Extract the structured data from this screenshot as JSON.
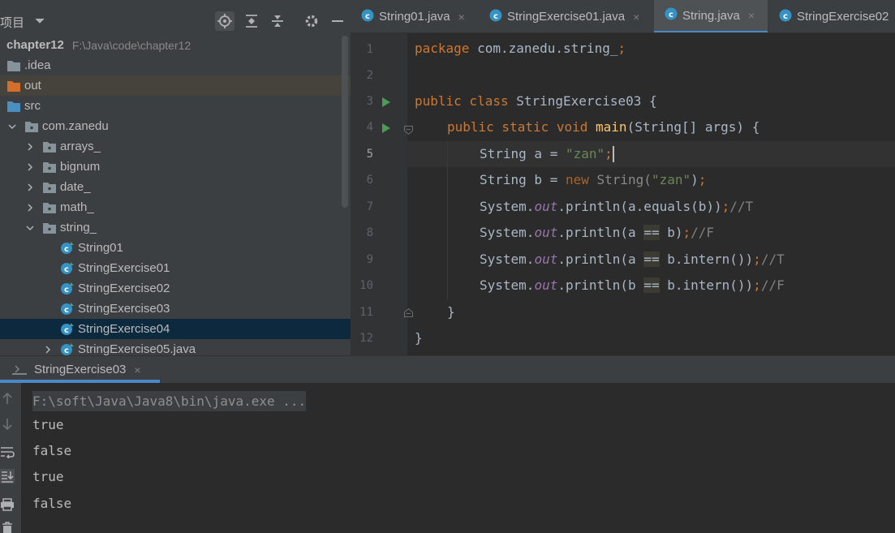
{
  "project_panel": {
    "title": "项目",
    "root_name": "chapter12",
    "root_path": "F:\\Java\\code\\chapter12",
    "items": [
      {
        "label": "chapter12",
        "kind": "module"
      },
      {
        "label": ".idea",
        "kind": "folder"
      },
      {
        "label": "out",
        "kind": "folder-excluded"
      },
      {
        "label": "src",
        "kind": "folder-source"
      },
      {
        "label": "com.zanedu",
        "kind": "package"
      },
      {
        "label": "arrays_",
        "kind": "package"
      },
      {
        "label": "bignum",
        "kind": "package"
      },
      {
        "label": "date_",
        "kind": "package"
      },
      {
        "label": "math_",
        "kind": "package"
      },
      {
        "label": "string_",
        "kind": "package"
      },
      {
        "label": "String01",
        "kind": "class"
      },
      {
        "label": "StringExercise01",
        "kind": "class"
      },
      {
        "label": "StringExercise02",
        "kind": "class"
      },
      {
        "label": "StringExercise03",
        "kind": "class"
      },
      {
        "label": "StringExercise04",
        "kind": "class"
      },
      {
        "label": "StringExercise05.java",
        "kind": "class"
      }
    ]
  },
  "editor_tabs": [
    {
      "label": "String01.java",
      "close": "×"
    },
    {
      "label": "StringExercise01.java",
      "close": "×"
    },
    {
      "label": "String.java",
      "close": "×"
    },
    {
      "label": "StringExercise02",
      "close": ""
    }
  ],
  "editor": {
    "line_numbers": [
      "1",
      "2",
      "3",
      "4",
      "5",
      "6",
      "7",
      "8",
      "9",
      "10",
      "11",
      "12"
    ],
    "code": {
      "l1_kw": "package",
      "l1_rest": " com.zanedu.string_",
      "l1_semi": ";",
      "l3_kw": "public class",
      "l3_rest": " StringExercise03 {",
      "l4_kw": "public static void",
      "l4_fn": "main",
      "l4_rest": "(String[] args) {",
      "l5_a": "String a = ",
      "l5_str": "\"zan\"",
      "l5_semi": ";",
      "l6_a": "String b = ",
      "l6_new": "new ",
      "l6_b": "String(",
      "l6_str": "\"zan\"",
      "l6_c": ")",
      "l6_semi": ";",
      "l7_a": "System.",
      "l7_out": "out",
      "l7_b": ".println(a.equals(b))",
      "l7_semi": ";",
      "l7_cmt": "//T",
      "l8_a": "System.",
      "l8_out": "out",
      "l8_b": ".println(a ",
      "l8_eq": "==",
      "l8_c": " b)",
      "l8_semi": ";",
      "l8_cmt": "//F",
      "l9_a": "System.",
      "l9_out": "out",
      "l9_b": ".println(a ",
      "l9_eq": "==",
      "l9_c": " b.intern())",
      "l9_semi": ";",
      "l9_cmt": "//T",
      "l10_a": "System.",
      "l10_out": "out",
      "l10_b": ".println(b ",
      "l10_eq": "==",
      "l10_c": " b.intern())",
      "l10_semi": ";",
      "l10_cmt": "//F",
      "l11": "}",
      "l12": "}"
    }
  },
  "run_panel": {
    "tab_label": "StringExercise03",
    "tab_close": "×",
    "command": "F:\\soft\\Java\\Java8\\bin\\java.exe ...",
    "output": [
      "true",
      "false",
      "true",
      "false"
    ]
  },
  "colors": {
    "keyword": "#cc7832",
    "string": "#6a8759",
    "field": "#9876aa",
    "comment": "#808080",
    "accent": "#4a88c7"
  }
}
